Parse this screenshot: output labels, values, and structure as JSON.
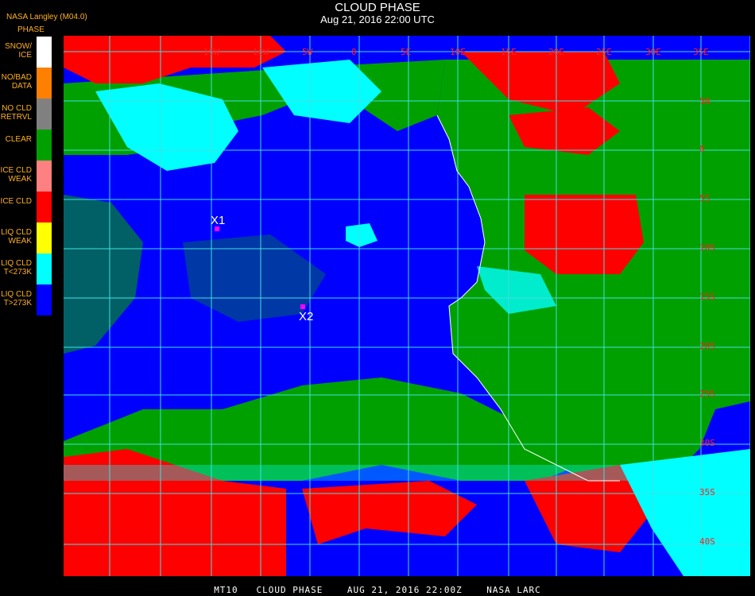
{
  "header": {
    "title": "CLOUD PHASE",
    "subtitle": "Aug 21, 2016 22:00 UTC",
    "credit": "NASA Langley (M04.0)"
  },
  "legend": {
    "heading": "PHASE",
    "items": [
      {
        "label": "SNOW/\nICE",
        "color": "#ffffff"
      },
      {
        "label": "NO/BAD\nDATA",
        "color": "#ff8000"
      },
      {
        "label": "NO CLD\nRETRVL",
        "color": "#808080"
      },
      {
        "label": "CLEAR",
        "color": "#00a000"
      },
      {
        "label": "ICE CLD\nWEAK",
        "color": "#ff8080"
      },
      {
        "label": "ICE CLD",
        "color": "#ff0000"
      },
      {
        "label": "LIQ CLD\nWEAK",
        "color": "#ffff00"
      },
      {
        "label": "LIQ CLD\nT<273K",
        "color": "#00ffff"
      },
      {
        "label": "LIQ CLD\nT>273K",
        "color": "#0000ff"
      }
    ]
  },
  "map": {
    "lon_labels": [
      "15W",
      "10W",
      "5W",
      "0",
      "5E",
      "10E",
      "15E",
      "20E",
      "25E",
      "30E",
      "35E"
    ],
    "lat_labels": [
      "5N",
      "0",
      "5S",
      "10S",
      "15S",
      "20S",
      "25S",
      "30S",
      "35S",
      "40S"
    ],
    "markers": [
      {
        "label": "X1",
        "color": "#ff00ff"
      },
      {
        "label": "X2",
        "color": "#ff00ff"
      }
    ]
  },
  "footer": {
    "text": "MT10   CLOUD PHASE    AUG 21, 2016 22:00Z    NASA LARC"
  }
}
